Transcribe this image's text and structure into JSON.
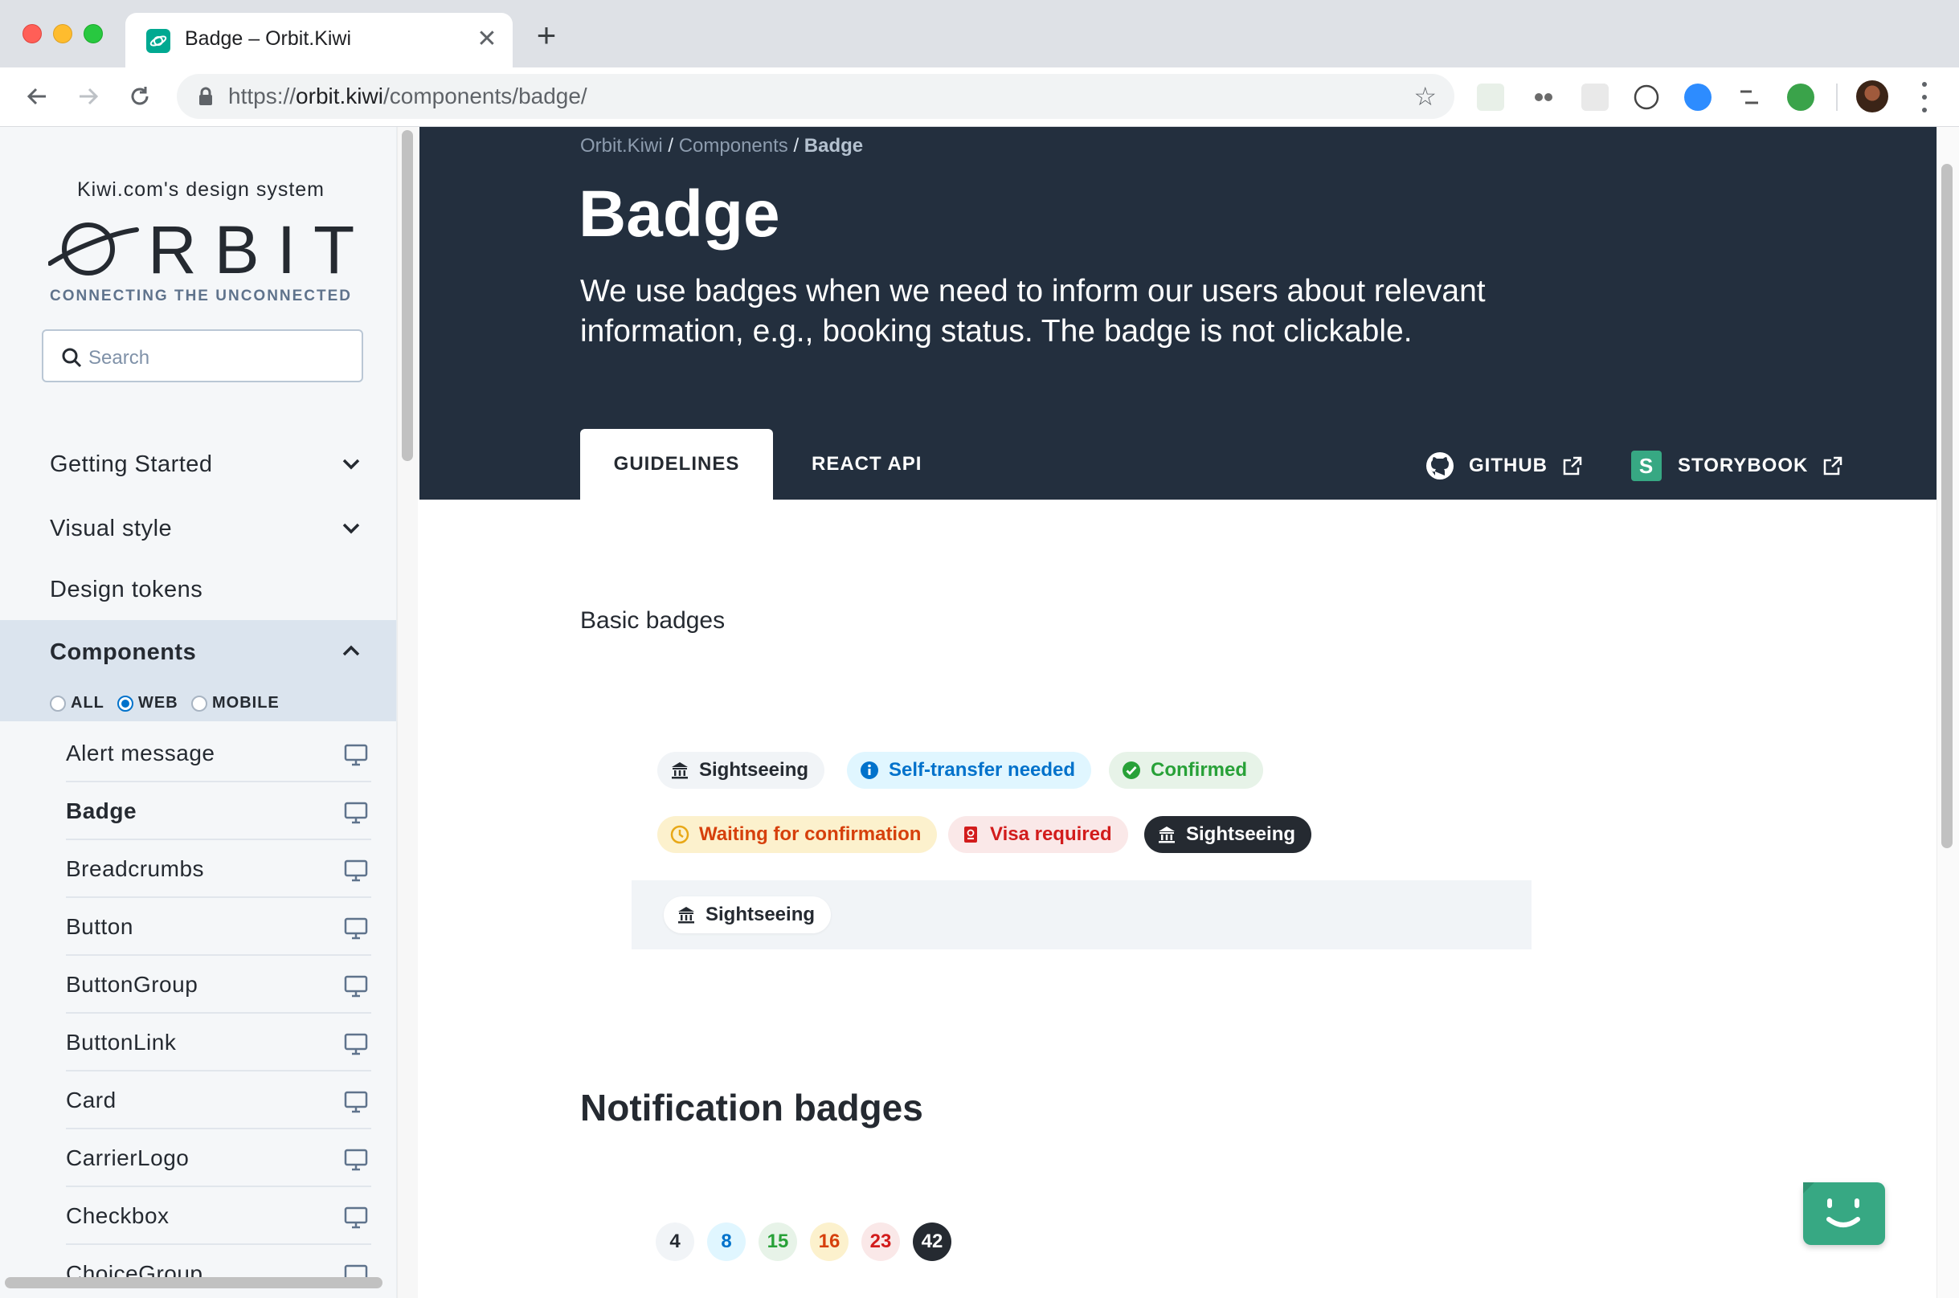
{
  "browser": {
    "tab_title": "Badge – Orbit.Kiwi",
    "url_scheme": "https://",
    "url_host": "orbit.kiwi",
    "url_path": "/components/badge/",
    "new_tab_symbol": "+",
    "close_symbol": "✕",
    "star_symbol": "☆",
    "traffic_colors": [
      "#ff5f57",
      "#febc2e",
      "#28c840"
    ]
  },
  "sidebar": {
    "tagline": "Kiwi.com's design system",
    "logo_text": "RBIT",
    "motto": "CONNECTING THE UNCONNECTED",
    "search_placeholder": "Search",
    "sections": [
      {
        "label": "Getting Started",
        "expanded": false
      },
      {
        "label": "Visual style",
        "expanded": false
      },
      {
        "label": "Design tokens"
      },
      {
        "label": "Components",
        "expanded": true,
        "active": true
      }
    ],
    "filters": [
      {
        "label": "ALL",
        "checked": false
      },
      {
        "label": "WEB",
        "checked": true
      },
      {
        "label": "MOBILE",
        "checked": false
      }
    ],
    "components": [
      {
        "label": "Alert message",
        "icon": "monitor-icon"
      },
      {
        "label": "Badge",
        "icon": "monitor-icon",
        "current": true
      },
      {
        "label": "Breadcrumbs",
        "icon": "monitor-icon"
      },
      {
        "label": "Button",
        "icon": "monitor-icon"
      },
      {
        "label": "ButtonGroup",
        "icon": "monitor-icon"
      },
      {
        "label": "ButtonLink",
        "icon": "monitor-icon"
      },
      {
        "label": "Card",
        "icon": "monitor-icon"
      },
      {
        "label": "CarrierLogo",
        "icon": "monitor-icon"
      },
      {
        "label": "Checkbox",
        "icon": "monitor-icon"
      },
      {
        "label": "ChoiceGroup",
        "icon": "monitor-icon"
      }
    ]
  },
  "hero": {
    "breadcrumbs": [
      "Orbit.Kiwi",
      "Components",
      "Badge"
    ],
    "breadcrumb_separator": "/",
    "title": "Badge",
    "description": "We use badges when we need to inform our users about relevant information, e.g., booking status. The badge is not clickable.",
    "tabs": [
      {
        "label": "GUIDELINES",
        "active": true
      },
      {
        "label": "REACT API",
        "active": false
      }
    ],
    "links": [
      {
        "label": "GITHUB",
        "icon": "github-icon"
      },
      {
        "label": "STORYBOOK",
        "icon": "storybook-icon",
        "logo_letter": "S"
      }
    ],
    "background_color": "#232f3e"
  },
  "content": {
    "basic_label": "Basic badges",
    "badges_row1": [
      {
        "label": "Sightseeing",
        "type": "neutral",
        "icon": "museum-icon"
      },
      {
        "label": "Self-transfer needed",
        "type": "info",
        "icon": "info-circle-icon"
      },
      {
        "label": "Confirmed",
        "type": "success",
        "icon": "check-circle-icon"
      }
    ],
    "badges_row2": [
      {
        "label": "Waiting for confirmation",
        "type": "warning",
        "icon": "clock-icon"
      },
      {
        "label": "Visa required",
        "type": "critical",
        "icon": "passport-icon"
      },
      {
        "label": "Sightseeing",
        "type": "dark",
        "icon": "museum-icon"
      }
    ],
    "badges_row3": [
      {
        "label": "Sightseeing",
        "type": "white",
        "icon": "museum-icon"
      }
    ],
    "notification_heading": "Notification badges",
    "notification_badges": [
      {
        "value": "4",
        "type": "neutral"
      },
      {
        "value": "8",
        "type": "info"
      },
      {
        "value": "15",
        "type": "success"
      },
      {
        "value": "16",
        "type": "warning"
      },
      {
        "value": "23",
        "type": "critical"
      },
      {
        "value": "42",
        "type": "dark"
      }
    ]
  },
  "colors": {
    "accent_green": "#00a991",
    "info": "#0172cb",
    "success": "#28a138",
    "warning": "#d6400c",
    "critical": "#d21c1c",
    "dark": "#252a31"
  }
}
